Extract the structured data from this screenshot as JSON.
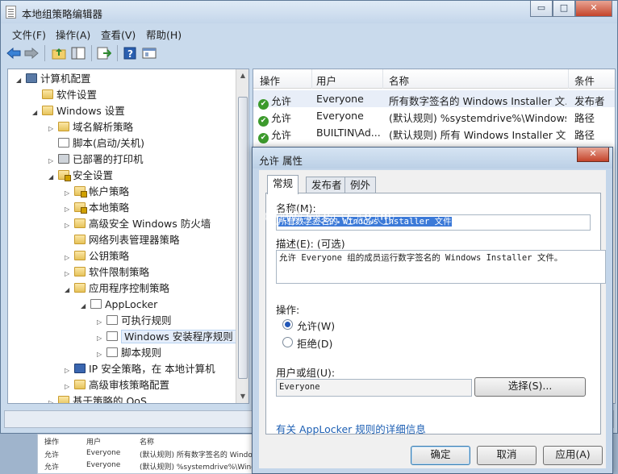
{
  "window": {
    "title": "本地组策略编辑器",
    "controls": [
      "▭",
      "□",
      "✕"
    ]
  },
  "menu": [
    "文件(F)",
    "操作(A)",
    "查看(V)",
    "帮助(H)"
  ],
  "toolbar": {
    "icons": [
      "back-arrow-icon",
      "forward-arrow-icon",
      "up-folder-icon",
      "show-hide-tree-icon",
      "export-list-icon",
      "help-icon",
      "properties-icon"
    ]
  },
  "tree": [
    {
      "label": "计算机配置",
      "arrow": "◢",
      "icon": "pc"
    },
    {
      "label": "软件设置",
      "arrow": "",
      "icon": "folder"
    },
    {
      "label": "Windows 设置",
      "arrow": "◢",
      "icon": "folder"
    },
    {
      "label": "域名解析策略",
      "arrow": "▷",
      "icon": "folder"
    },
    {
      "label": "脚本(启动/关机)",
      "arrow": "",
      "icon": "doc"
    },
    {
      "label": "已部署的打印机",
      "arrow": "▷",
      "icon": "printer"
    },
    {
      "label": "安全设置",
      "arrow": "◢",
      "icon": "lockfolder"
    },
    {
      "label": "帐户策略",
      "arrow": "▷",
      "icon": "lockfolder"
    },
    {
      "label": "本地策略",
      "arrow": "▷",
      "icon": "lockfolder"
    },
    {
      "label": "高级安全 Windows 防火墙",
      "arrow": "▷",
      "icon": "folder"
    },
    {
      "label": "网络列表管理器策略",
      "arrow": "",
      "icon": "folder"
    },
    {
      "label": "公钥策略",
      "arrow": "▷",
      "icon": "folder"
    },
    {
      "label": "软件限制策略",
      "arrow": "▷",
      "icon": "folder"
    },
    {
      "label": "应用程序控制策略",
      "arrow": "◢",
      "icon": "folder"
    },
    {
      "label": "AppLocker",
      "arrow": "◢",
      "icon": "doc"
    },
    {
      "label": "可执行规则",
      "arrow": "▷",
      "icon": "doc"
    },
    {
      "label": "Windows 安装程序规则",
      "arrow": "▷",
      "icon": "doc"
    },
    {
      "label": "脚本规则",
      "arrow": "▷",
      "icon": "doc"
    },
    {
      "label": "IP 安全策略，在 本地计算机",
      "arrow": "▷",
      "icon": "shield"
    },
    {
      "label": "高级审核策略配置",
      "arrow": "▷",
      "icon": "folder"
    },
    {
      "label": "基于策略的 QoS",
      "arrow": "▷",
      "icon": "folder"
    }
  ],
  "list": {
    "headers": [
      "操作",
      "用户",
      "名称",
      "条件"
    ],
    "rows": [
      {
        "action": "允许",
        "user": "Everyone",
        "name": "所有数字签名的 Windows Installer 文...",
        "condition": "发布者"
      },
      {
        "action": "允许",
        "user": "Everyone",
        "name": "(默认规则) %systemdrive%\\Windows...",
        "condition": "路径"
      },
      {
        "action": "允许",
        "user": "BUILTIN\\Ad...",
        "name": "(默认规则) 所有 Windows Installer 文...",
        "condition": "路径"
      }
    ]
  },
  "peek": {
    "headers": [
      "操作",
      "用户",
      "名称"
    ],
    "rows": [
      {
        "action": "允许",
        "user": "Everyone",
        "name": "(默认规则) 所有数字签名的 Windo"
      },
      {
        "action": "允许",
        "user": "Everyone",
        "name": "(默认规则) %systemdrive%\\Windo"
      }
    ]
  },
  "dialog": {
    "title": "允许 属性",
    "close": "✕",
    "tabs": [
      "常规",
      "发布者",
      "例外"
    ],
    "name_label": "名称(M):",
    "name_value": "所有数字签名的 Windows Installer 文件",
    "desc_label": "描述(E): (可选)",
    "desc_value": "允许 Everyone 组的成员运行数字签名的 Windows Installer 文件。",
    "action_label": "操作:",
    "allow_label": "允许(W)",
    "deny_label": "拒绝(D)",
    "user_label": "用户或组(U):",
    "user_value": "Everyone",
    "select_button": "选择(S)...",
    "info_link": "有关 AppLocker 规则的详细信息",
    "ok": "确定",
    "cancel": "取消",
    "apply": "应用(A)"
  },
  "watermark": "ⓟⓌⓢⓖ.ⓒⓞⓜ"
}
